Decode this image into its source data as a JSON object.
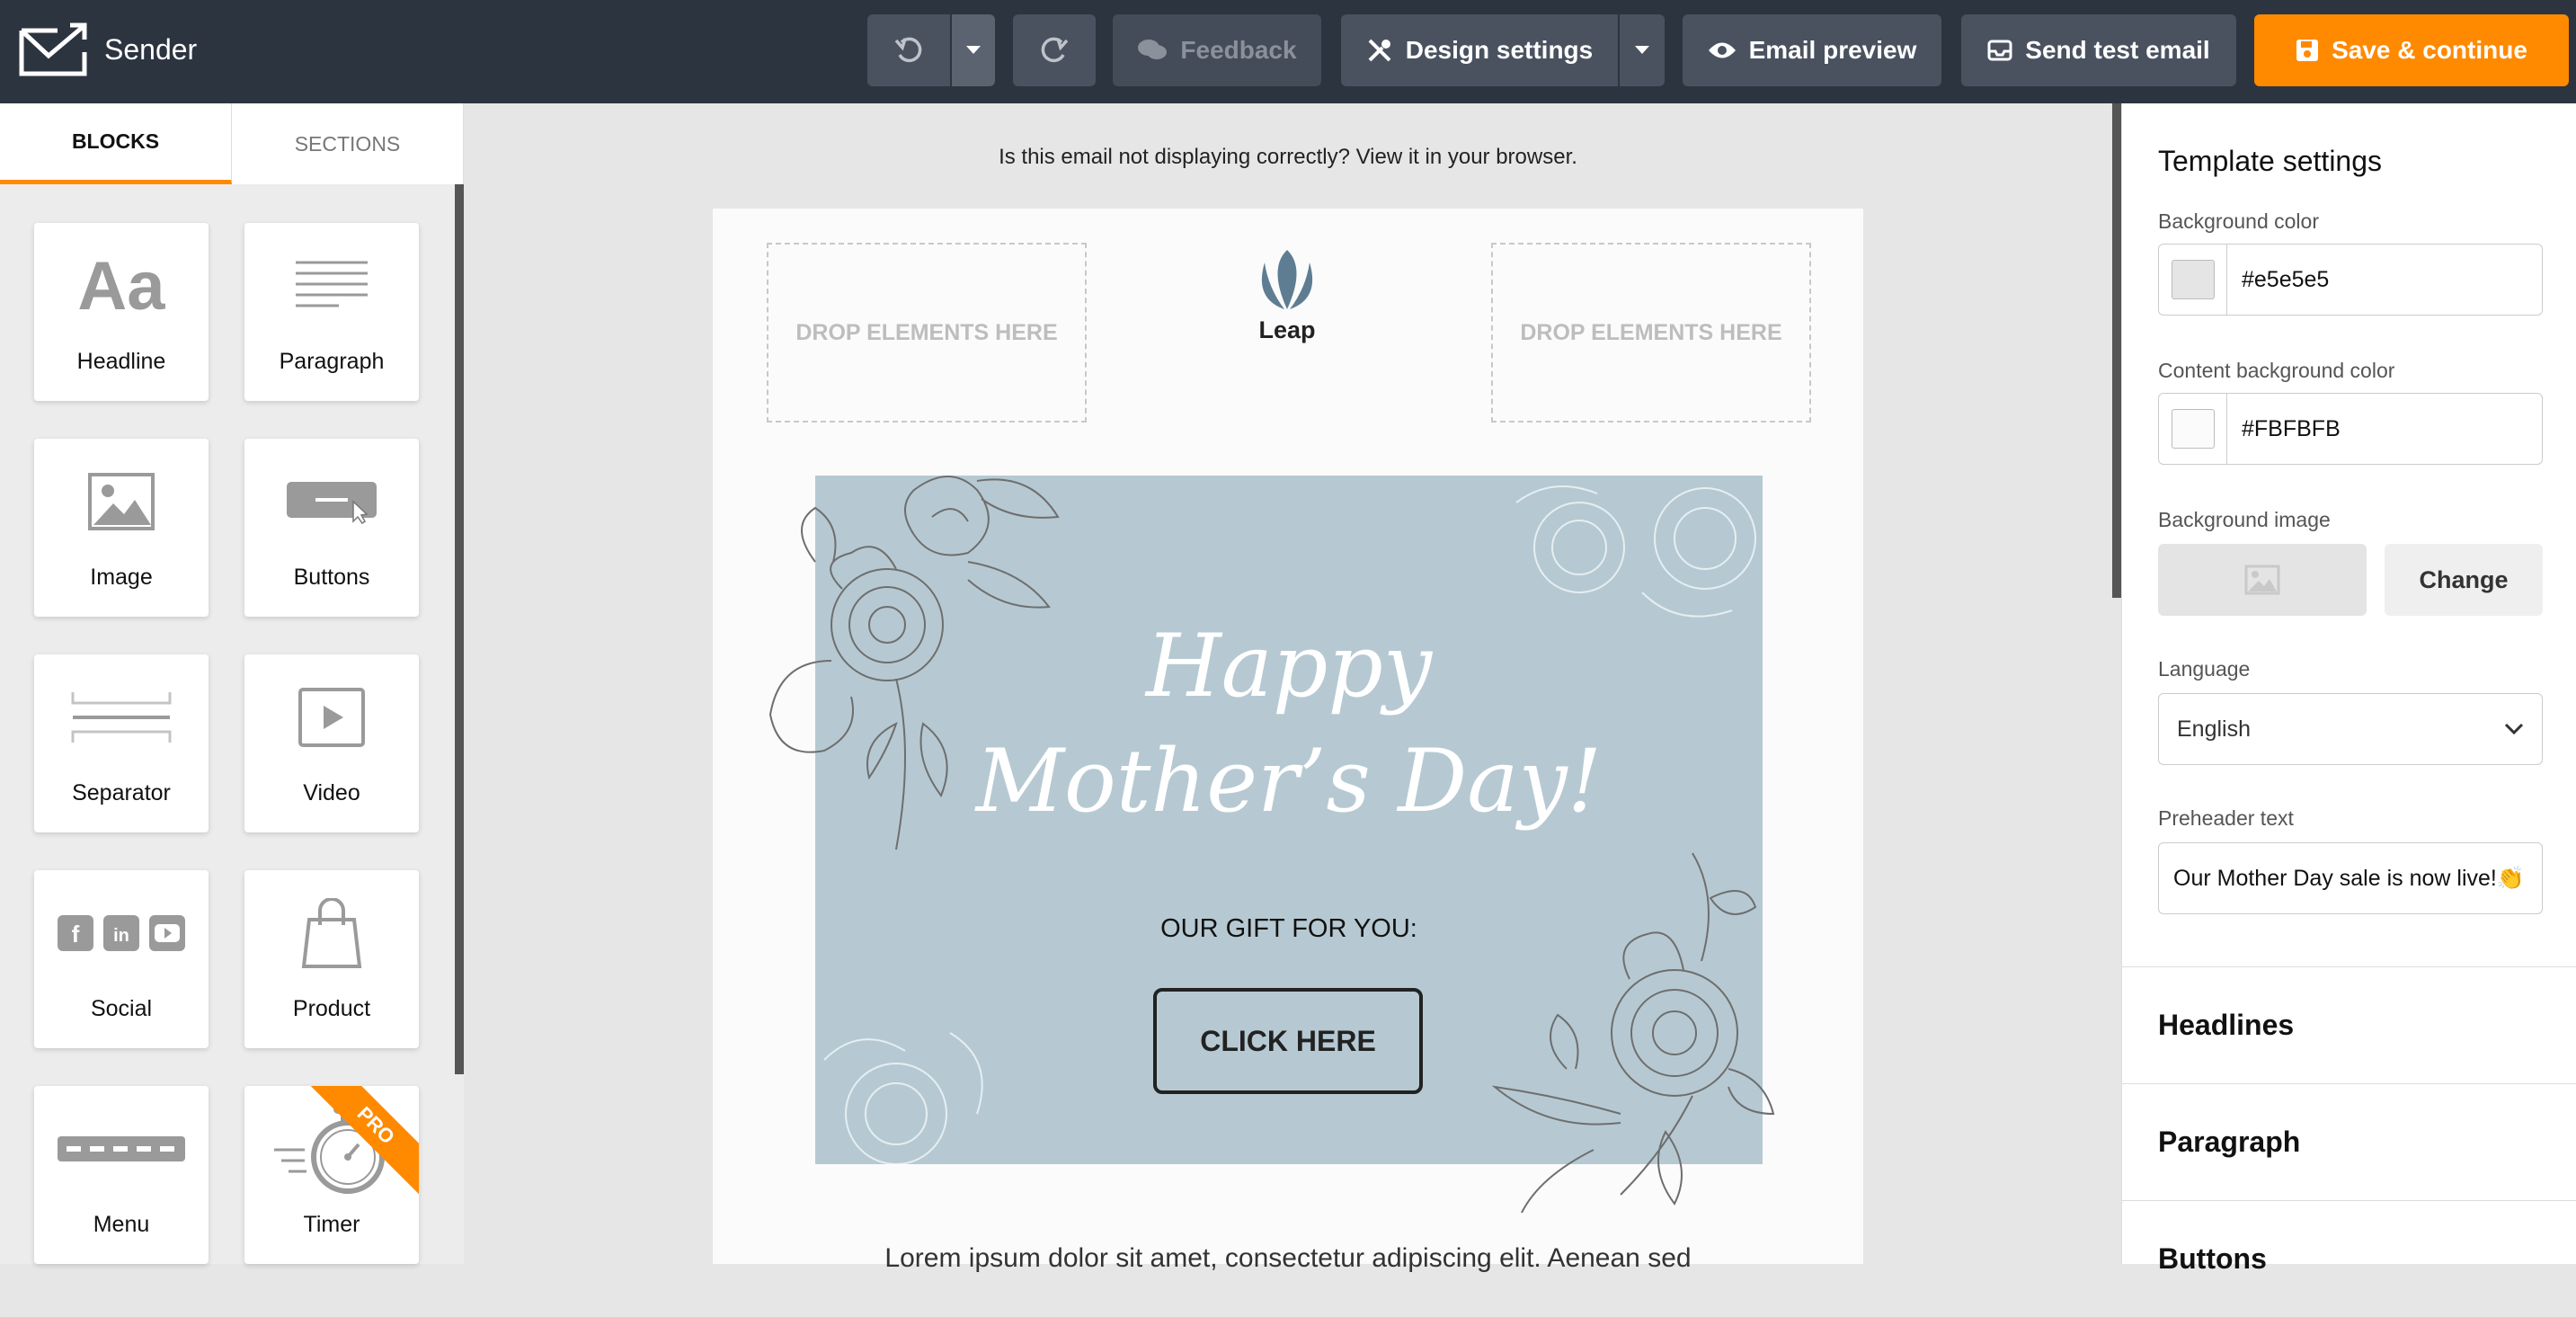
{
  "app": {
    "name": "Sender",
    "logo_icon": "envelope-arrow-icon"
  },
  "toolbar": {
    "undo_icon": "undo-icon",
    "undo_menu_icon": "chevron-down-icon",
    "redo_icon": "redo-icon",
    "feedback_label": "Feedback",
    "design_settings_label": "Design settings",
    "email_preview_label": "Email preview",
    "send_test_label": "Send test email",
    "save_label": "Save & continue",
    "accent_color": "#ff8a00"
  },
  "left_panel": {
    "tabs": [
      {
        "label": "BLOCKS"
      },
      {
        "label": "SECTIONS"
      }
    ],
    "blocks": [
      {
        "label": "Headline",
        "icon": "headline-icon"
      },
      {
        "label": "Paragraph",
        "icon": "paragraph-icon"
      },
      {
        "label": "Image",
        "icon": "image-icon"
      },
      {
        "label": "Buttons",
        "icon": "button-icon"
      },
      {
        "label": "Separator",
        "icon": "separator-icon"
      },
      {
        "label": "Video",
        "icon": "video-icon"
      },
      {
        "label": "Social",
        "icon": "social-icon"
      },
      {
        "label": "Product",
        "icon": "shopping-bag-icon"
      },
      {
        "label": "Menu",
        "icon": "menu-icon"
      },
      {
        "label": "Timer",
        "icon": "timer-icon",
        "badge": "PRO"
      }
    ]
  },
  "canvas": {
    "notice": "Is this email not displaying correctly? View it in your browser.",
    "drop_left": "DROP ELEMENTS HERE",
    "drop_right": "DROP ELEMENTS HERE",
    "brand_name": "Leap",
    "hero_line1": "Happy",
    "hero_line2": "Mother’s Day!",
    "gift_text": "OUR GIFT FOR YOU:",
    "cta_label": "CLICK HERE",
    "lorem": "Lorem ipsum dolor sit amet, consectetur adipiscing elit. Aenean sed"
  },
  "template_settings": {
    "title": "Template settings",
    "background_color_label": "Background color",
    "background_color": "#e5e5e5",
    "content_bg_label": "Content background color",
    "content_bg_color": "#FBFBFB",
    "background_image_label": "Background image",
    "change_label": "Change",
    "language_label": "Language",
    "language_value": "English",
    "preheader_label": "Preheader text",
    "preheader_value": "Our Mother Day sale is now live!👏"
  },
  "sections": [
    {
      "label": "Headlines"
    },
    {
      "label": "Paragraph"
    },
    {
      "label": "Buttons"
    }
  ]
}
